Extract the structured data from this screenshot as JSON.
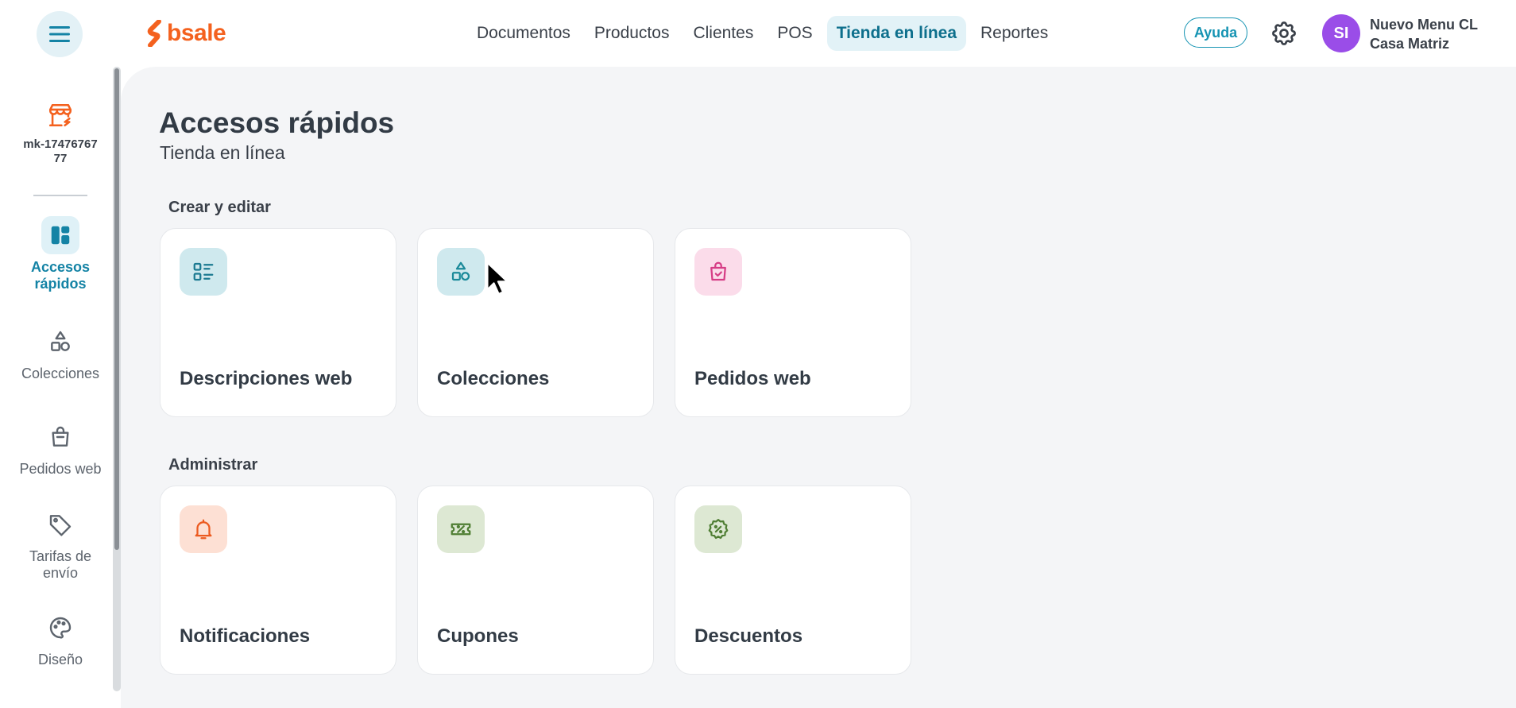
{
  "header": {
    "brand": "bsale",
    "nav": [
      "Documentos",
      "Productos",
      "Clientes",
      "POS",
      "Tienda en línea",
      "Reportes"
    ],
    "active_nav": "Tienda en línea",
    "help_label": "Ayuda",
    "avatar_initials": "SI",
    "user_name": "Nuevo Menu CL",
    "user_branch": "Casa Matriz"
  },
  "sidebar": {
    "store_name": "mk-1747676777",
    "items": [
      {
        "label": "Accesos rápidos",
        "icon": "dashboard-icon",
        "active": true
      },
      {
        "label": "Colecciones",
        "icon": "shapes-icon",
        "active": false
      },
      {
        "label": "Pedidos web",
        "icon": "shopping-bag-icon",
        "active": false
      },
      {
        "label": "Tarifas de envío",
        "icon": "tag-icon",
        "active": false
      },
      {
        "label": "Diseño",
        "icon": "palette-icon",
        "active": false
      }
    ]
  },
  "main": {
    "title": "Accesos rápidos",
    "subtitle": "Tienda en línea",
    "sections": [
      {
        "title": "Crear y editar",
        "cards": [
          {
            "label": "Descripciones web",
            "icon": "list-details-icon",
            "icon_bg": "#cfe9ee",
            "icon_color": "#1b7a91"
          },
          {
            "label": "Colecciones",
            "icon": "shapes-icon",
            "icon_bg": "#cfe9ee",
            "icon_color": "#1b8a9a"
          },
          {
            "label": "Pedidos web",
            "icon": "shopping-bag-check-icon",
            "icon_bg": "#fbdcea",
            "icon_color": "#d63d86"
          }
        ]
      },
      {
        "title": "Administrar",
        "cards": [
          {
            "label": "Notificaciones",
            "icon": "bell-icon",
            "icon_bg": "#fde0d4",
            "icon_color": "#ec5a1f"
          },
          {
            "label": "Cupones",
            "icon": "ticket-icon",
            "icon_bg": "#dde8d3",
            "icon_color": "#4f7e33"
          },
          {
            "label": "Descuentos",
            "icon": "discount-badge-icon",
            "icon_bg": "#dde8d3",
            "icon_color": "#4f7e33"
          }
        ]
      }
    ]
  },
  "colors": {
    "brand_orange": "#f4611e",
    "accent_teal": "#1483a5",
    "avatar_purple": "#9a4de8",
    "main_bg": "#f4f5f7"
  }
}
